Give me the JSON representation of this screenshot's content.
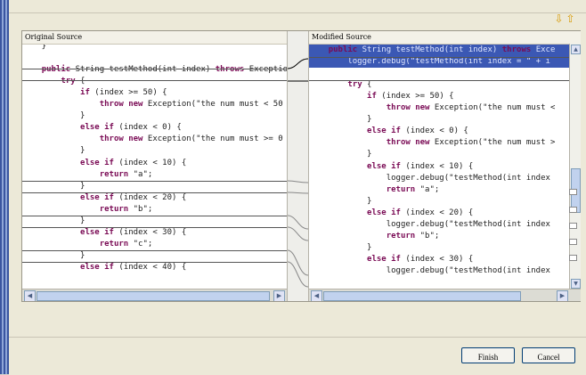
{
  "nav": {
    "up_icon": "arrow-up-icon",
    "down_icon": "arrow-down-icon",
    "down_glyph": "⇩",
    "up_glyph": "⇧"
  },
  "left_pane": {
    "title": "Original Source",
    "lines": [
      "    }",
      "",
      "    public String testMethod(int index) throws Exceptio",
      "        try {",
      "            if (index >= 50) {",
      "                throw new Exception(\"the num must < 50",
      "            }",
      "            else if (index < 0) {",
      "                throw new Exception(\"the num must >= 0",
      "            }",
      "            else if (index < 10) {",
      "                return \"a\";",
      "            }",
      "            else if (index < 20) {",
      "                return \"b\";",
      "            }",
      "            else if (index < 30) {",
      "                return \"c\";",
      "            }",
      "            else if (index < 40) {"
    ]
  },
  "right_pane": {
    "title": "Modified Source",
    "lines": [
      "    public String testMethod(int index) throws Exce",
      "        logger.debug(\"testMethod(int index = \" + i",
      "",
      "        try {",
      "            if (index >= 50) {",
      "                throw new Exception(\"the num must <",
      "            }",
      "            else if (index < 0) {",
      "                throw new Exception(\"the num must >",
      "            }",
      "            else if (index < 10) {",
      "                logger.debug(\"testMethod(int index",
      "                return \"a\";",
      "            }",
      "            else if (index < 20) {",
      "                logger.debug(\"testMethod(int index",
      "                return \"b\";",
      "            }",
      "            else if (index < 30) {",
      "                logger.debug(\"testMethod(int index"
    ]
  },
  "buttons": {
    "finish": "Finish",
    "cancel": "Cancel"
  },
  "colors": {
    "highlight": "#3b58b4",
    "keyword": "#7a0b55",
    "nav_arrow": "#d79a06"
  }
}
